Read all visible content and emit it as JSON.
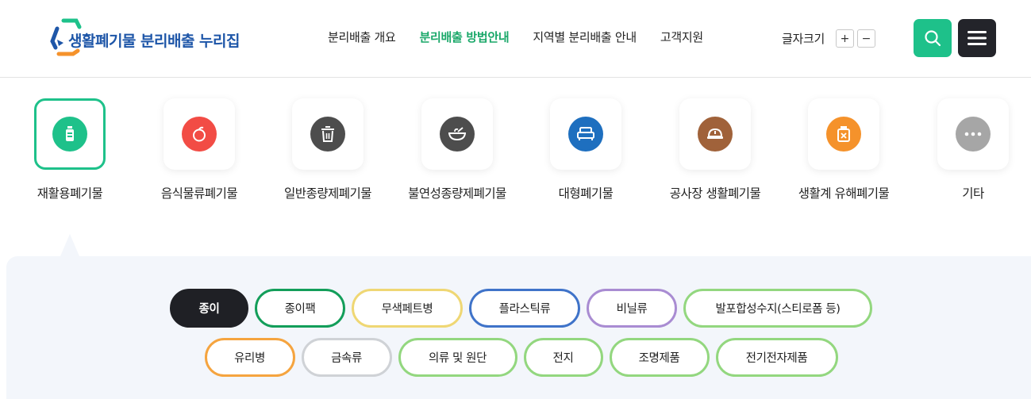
{
  "header": {
    "logo_text": "생활폐기물 분리배출 누리집",
    "nav": [
      {
        "label": "분리배출 개요",
        "active": false
      },
      {
        "label": "분리배출 방법안내",
        "active": true
      },
      {
        "label": "지역별 분리배출 안내",
        "active": false
      },
      {
        "label": "고객지원",
        "active": false
      }
    ],
    "font_size_label": "글자크기",
    "font_increase": "+",
    "font_decrease": "−",
    "search_icon": "search-icon",
    "menu_icon": "hamburger-menu-icon"
  },
  "categories": [
    {
      "label": "재활용폐기물",
      "icon": "bottle-icon",
      "color": "#1ec18a",
      "selected": true
    },
    {
      "label": "음식물류폐기물",
      "icon": "apple-icon",
      "color": "#f24c45",
      "selected": false
    },
    {
      "label": "일반종량제폐기물",
      "icon": "trash-can-icon",
      "color": "#4d4d4d",
      "selected": false
    },
    {
      "label": "불연성종량제폐기물",
      "icon": "bowl-icon",
      "color": "#4d4d4d",
      "selected": false
    },
    {
      "label": "대형폐기물",
      "icon": "bed-icon",
      "color": "#1e6fbf",
      "selected": false
    },
    {
      "label": "공사장 생활폐기물",
      "icon": "hard-hat-icon",
      "color": "#a0623a",
      "selected": false
    },
    {
      "label": "생활계 유해폐기물",
      "icon": "hazard-jar-icon",
      "color": "#f5922b",
      "selected": false
    },
    {
      "label": "기타",
      "icon": "more-dots-icon",
      "color": "#a6a6a6",
      "selected": false
    }
  ],
  "subcategories_row1": [
    {
      "label": "종이",
      "border": "#1f2025",
      "active": true
    },
    {
      "label": "종이팩",
      "border": "#139e5a",
      "active": false
    },
    {
      "label": "무색페트병",
      "border": "#efd774",
      "active": false
    },
    {
      "label": "플라스틱류",
      "border": "#3f73c9",
      "active": false
    },
    {
      "label": "비닐류",
      "border": "#a98cd2",
      "active": false
    },
    {
      "label": "발포합성수지(스티로폼 등)",
      "border": "#93d77f",
      "active": false
    }
  ],
  "subcategories_row2": [
    {
      "label": "유리병",
      "border": "#f5a43f",
      "active": false
    },
    {
      "label": "금속류",
      "border": "#cfd2d6",
      "active": false
    },
    {
      "label": "의류 및 원단",
      "border": "#93d77f",
      "active": false
    },
    {
      "label": "전지",
      "border": "#93d77f",
      "active": false
    },
    {
      "label": "조명제품",
      "border": "#93d77f",
      "active": false
    },
    {
      "label": "전기전자제품",
      "border": "#93d77f",
      "active": false
    }
  ]
}
